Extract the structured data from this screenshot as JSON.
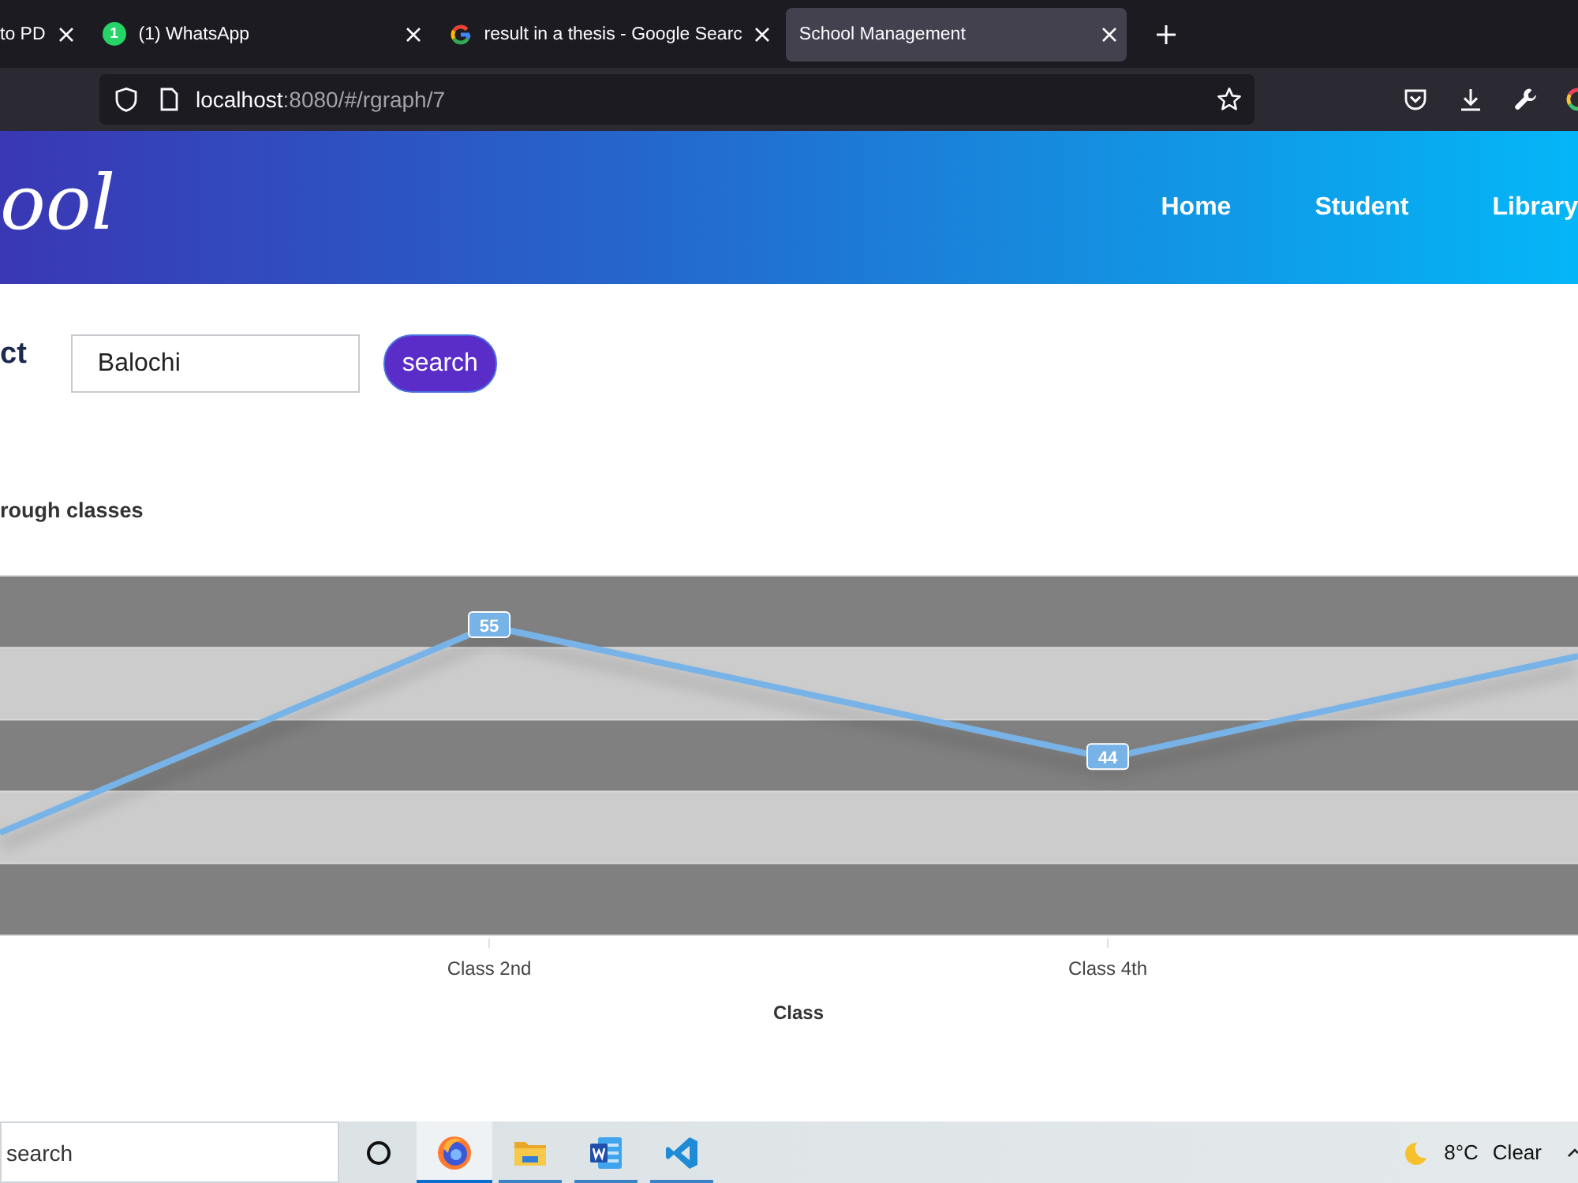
{
  "browser": {
    "tabs": [
      {
        "title": "to PD",
        "kind": "plain",
        "selected": false
      },
      {
        "title": "(1) WhatsApp",
        "kind": "chat",
        "badge": "1",
        "selected": false
      },
      {
        "title": "result in a thesis - Google Searc",
        "kind": "gletter",
        "selected": false
      },
      {
        "title": "School Management",
        "kind": "plain",
        "selected": true
      }
    ],
    "address": {
      "host": "localhost",
      "path": ":8080/#/rgraph/7"
    }
  },
  "header": {
    "logo": "ool",
    "nav": [
      {
        "label": "Home"
      },
      {
        "label": "Student"
      },
      {
        "label": "Library"
      }
    ]
  },
  "filter": {
    "label": "ct",
    "field": {
      "value": "Balochi"
    },
    "button": "search"
  },
  "chart": {
    "title": "rough classes",
    "points": [
      {
        "category": "Class 2nd",
        "label": "55"
      },
      {
        "category": "Class 4th",
        "label": "44"
      }
    ],
    "xlabel": "Class"
  },
  "taskbar": {
    "search": {
      "placeholder": "search"
    },
    "apps": [
      {
        "kind": "browser",
        "running": true,
        "selected": true
      },
      {
        "kind": "folder",
        "running": true,
        "selected": false
      },
      {
        "kind": "document",
        "running": true,
        "selected": false
      },
      {
        "kind": "code",
        "running": true,
        "selected": false
      }
    ],
    "weather": {
      "temperature": "8°C",
      "condition": "Clear"
    }
  }
}
